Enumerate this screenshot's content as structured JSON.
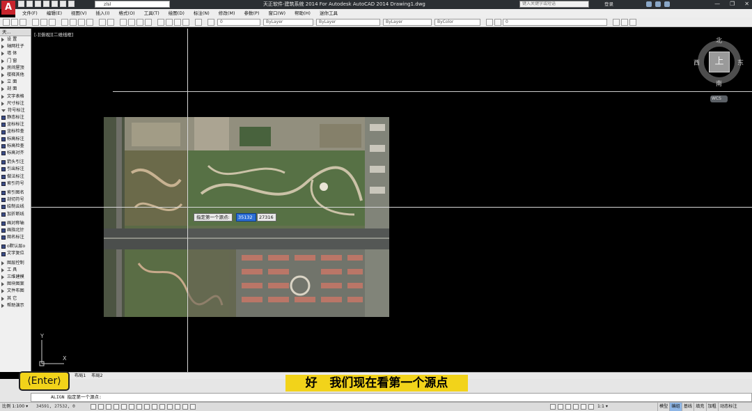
{
  "titlebar": {
    "app_logo": "A",
    "workspace": "zlsl",
    "title": "天正软件-建筑系统 2014  For Autodesk AutoCAD 2014    Drawing1.dwg",
    "search_placeholder": "键入关键字或短语",
    "login": "登录",
    "minimize": "—",
    "restore": "❐",
    "close": "✕"
  },
  "menus": [
    "文件(F)",
    "编辑(E)",
    "视图(V)",
    "插入(I)",
    "格式(O)",
    "工具(T)",
    "绘图(D)",
    "标注(N)",
    "修改(M)",
    "参数(P)",
    "窗口(W)",
    "帮助(H)",
    "迷你工具"
  ],
  "toolbar": {
    "layer_combo": "0",
    "color_combo": "ByLayer",
    "linetype_combo": "ByLayer",
    "lineweight_combo": "ByLayer",
    "plotstyle_combo": "ByColor",
    "layer_state": "0"
  },
  "left_panel": {
    "title": "天...",
    "items": [
      {
        "label": "设  置",
        "kind": "arrow"
      },
      {
        "label": "轴网柱子",
        "kind": "arrow"
      },
      {
        "label": "墙  体",
        "kind": "arrow"
      },
      {
        "label": "门  窗",
        "kind": "arrow"
      },
      {
        "label": "房间屋顶",
        "kind": "arrow"
      },
      {
        "label": "楼梯其他",
        "kind": "arrow"
      },
      {
        "label": "立  面",
        "kind": "arrow"
      },
      {
        "label": "剖  面",
        "kind": "arrow"
      },
      {
        "label": "文字表格",
        "kind": "arrow"
      },
      {
        "label": "尺寸标注",
        "kind": "arrow"
      },
      {
        "label": "符号标注",
        "kind": "down"
      },
      {
        "label": "静态标注",
        "kind": "icon"
      },
      {
        "label": "坐标标注",
        "kind": "icon"
      },
      {
        "label": "坐标检查",
        "kind": "icon"
      },
      {
        "label": "标高标注",
        "kind": "icon"
      },
      {
        "label": "标高检查",
        "kind": "icon"
      },
      {
        "label": "标高对齐",
        "kind": "icon"
      },
      {
        "label": "",
        "kind": "sep"
      },
      {
        "label": "箭头引注",
        "kind": "icon"
      },
      {
        "label": "引出标注",
        "kind": "icon"
      },
      {
        "label": "做法标注",
        "kind": "icon"
      },
      {
        "label": "索引符号",
        "kind": "icon"
      },
      {
        "label": "",
        "kind": "sep"
      },
      {
        "label": "索引图名",
        "kind": "icon"
      },
      {
        "label": "剖切符号",
        "kind": "icon"
      },
      {
        "label": "绘制云线",
        "kind": "icon"
      },
      {
        "label": "加折断线",
        "kind": "icon"
      },
      {
        "label": "",
        "kind": "sep"
      },
      {
        "label": "画对称轴",
        "kind": "icon"
      },
      {
        "label": "画指北针",
        "kind": "icon"
      },
      {
        "label": "图名标注",
        "kind": "icon"
      },
      {
        "label": "",
        "kind": "sep"
      },
      {
        "label": "o默认层o",
        "kind": "icon"
      },
      {
        "label": "文字复位",
        "kind": "icon"
      },
      {
        "label": "",
        "kind": "sep"
      },
      {
        "label": "图层控制",
        "kind": "arrow"
      },
      {
        "label": "工  具",
        "kind": "arrow"
      },
      {
        "label": "三维建模",
        "kind": "arrow"
      },
      {
        "label": "图块图案",
        "kind": "arrow"
      },
      {
        "label": "文件布图",
        "kind": "arrow"
      },
      {
        "label": "其  它",
        "kind": "arrow"
      },
      {
        "label": "帮助演示",
        "kind": "arrow"
      }
    ]
  },
  "viewport": {
    "label": "[-][俯视][二维线框]"
  },
  "dynamic_input": {
    "prompt": "指定第一个源点:",
    "x_value": "35132",
    "y_value": "27316"
  },
  "viewcube": {
    "north": "北",
    "south": "南",
    "east": "东",
    "west": "西",
    "face": "上",
    "wcs": "WCS"
  },
  "ucs": {
    "x": "X",
    "y": "Y"
  },
  "tabs": [
    "布局1",
    "布局2"
  ],
  "overlay": {
    "enter_key": "⟨Enter⟩",
    "subtitle": "好   我们现在看第一个源点"
  },
  "command_line": {
    "text": "ALIGN 指定第一个源点:"
  },
  "status": {
    "scale": "比例 1:100 ▾",
    "coords": "34591, 27532, 0",
    "ratio": "1:1 ▾",
    "buttons": [
      "模型",
      "编组",
      "基线",
      "填充",
      "加粗",
      "动态标注"
    ],
    "active_buttons": [
      "编组"
    ]
  },
  "colors": {
    "model_space": "#000000",
    "subtitle_bg": "#f2d31a",
    "selected_input": "#2d6fd6"
  }
}
